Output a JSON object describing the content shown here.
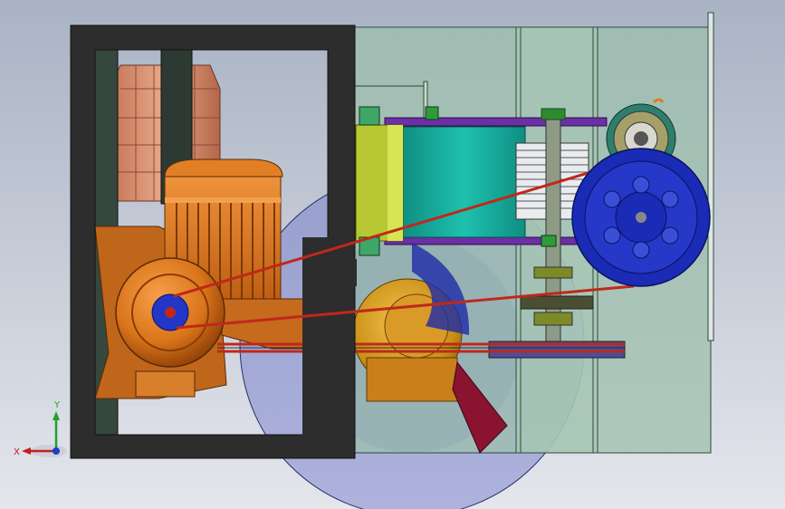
{
  "view": {
    "triad": {
      "x_label": "X",
      "y_label": "Y"
    },
    "colors": {
      "frame": "#2d2d2d",
      "housing": "#9dbfac",
      "motor": "#d9741a",
      "pulley_large": "#1a2bb5",
      "belt": "#c0281a",
      "fan": "#4e56b8",
      "teal_guard": "#15a99a",
      "yellow_green": "#b7c832",
      "purple_bar": "#6b2fa6",
      "copper_block": "#d08a6a",
      "maroon_blade": "#8a1430"
    }
  }
}
